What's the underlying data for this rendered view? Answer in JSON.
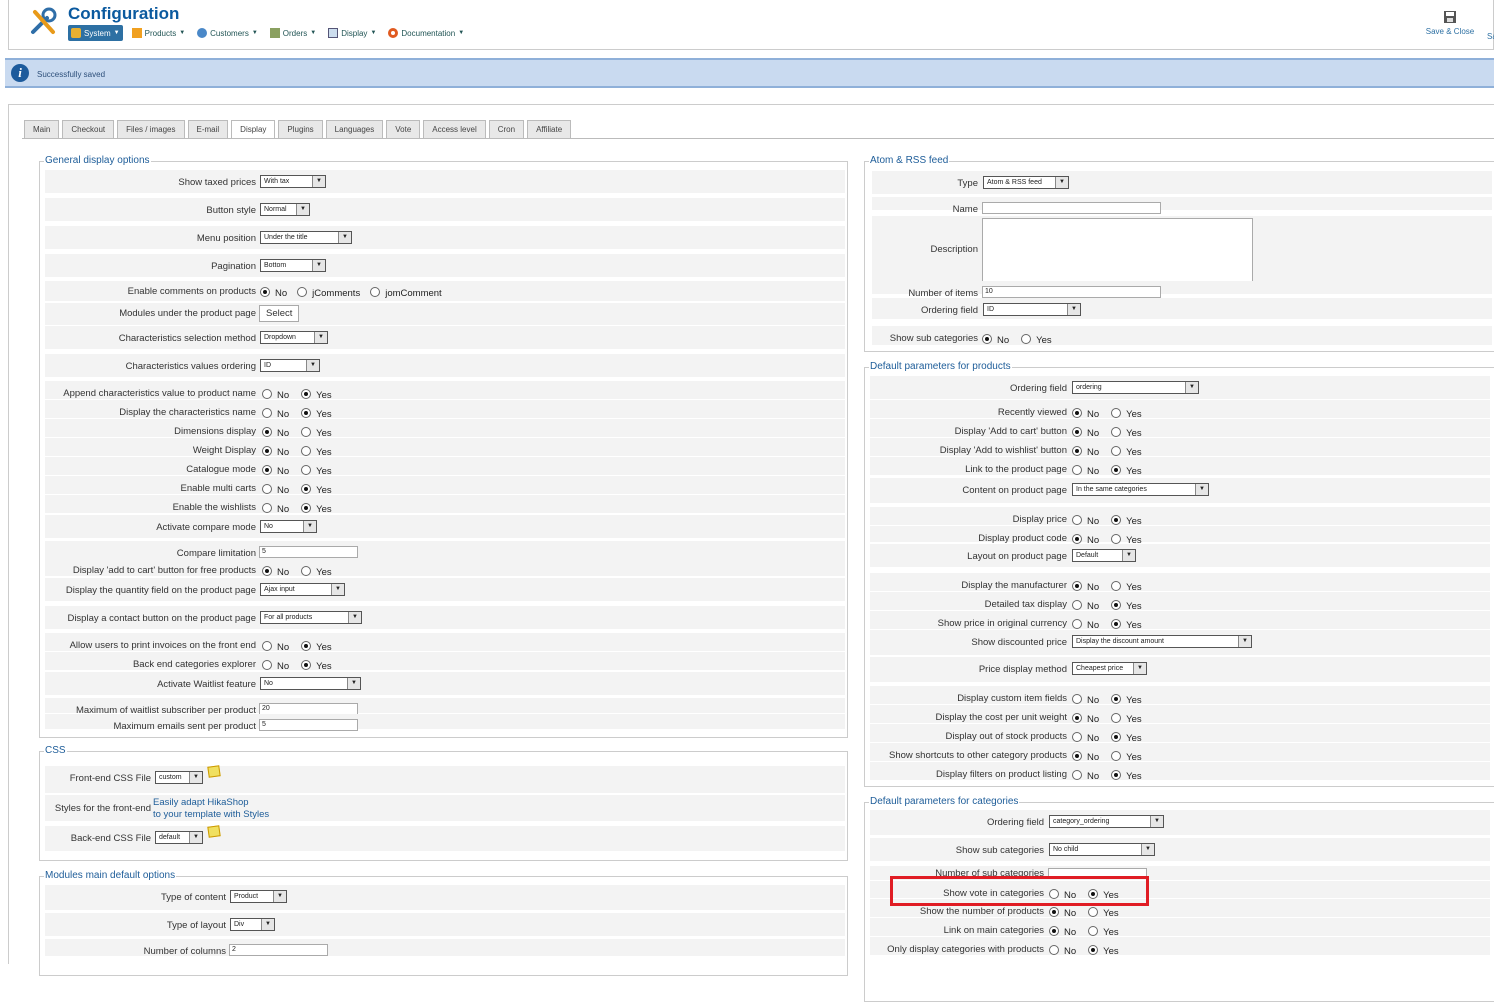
{
  "header": {
    "title": "Configuration",
    "menu": [
      {
        "label": "System",
        "icon": "wrench-icon",
        "active": true
      },
      {
        "label": "Products",
        "icon": "box-icon"
      },
      {
        "label": "Customers",
        "icon": "users-icon"
      },
      {
        "label": "Orders",
        "icon": "cart-icon"
      },
      {
        "label": "Display",
        "icon": "monitor-icon"
      },
      {
        "label": "Documentation",
        "icon": "lifebuoy-icon"
      }
    ],
    "save_close": "Save & Close",
    "save_more": "Sa"
  },
  "message": {
    "text": "Successfully saved",
    "icon": "info-icon"
  },
  "tabs": [
    "Main",
    "Checkout",
    "Files / images",
    "E-mail",
    "Display",
    "Plugins",
    "Languages",
    "Vote",
    "Access level",
    "Cron",
    "Affiliate"
  ],
  "active_tab": "Display",
  "general": {
    "legend": "General display options",
    "show_taxed_prices": {
      "label": "Show taxed prices",
      "value": "With tax"
    },
    "button_style": {
      "label": "Button style",
      "value": "Normal"
    },
    "menu_position": {
      "label": "Menu position",
      "value": "Under the title"
    },
    "pagination": {
      "label": "Pagination",
      "value": "Bottom"
    },
    "enable_comments": {
      "label": "Enable comments on products",
      "opt1": "No",
      "opt2": "jComments",
      "opt3": "jomComment"
    },
    "modules_under": {
      "label": "Modules under the product page",
      "button": "Select"
    },
    "char_selection": {
      "label": "Characteristics selection method",
      "value": "Dropdown"
    },
    "char_ordering": {
      "label": "Characteristics values ordering",
      "value": "ID"
    },
    "append_char": {
      "label": "Append characteristics value to product name"
    },
    "display_char_name": {
      "label": "Display the characteristics name"
    },
    "dimensions": {
      "label": "Dimensions display"
    },
    "weight": {
      "label": "Weight Display"
    },
    "catalogue": {
      "label": "Catalogue mode"
    },
    "multi_carts": {
      "label": "Enable multi carts"
    },
    "wishlists": {
      "label": "Enable the wishlists"
    },
    "compare_mode": {
      "label": "Activate compare mode",
      "value": "No"
    },
    "compare_limit": {
      "label": "Compare limitation",
      "value": "5"
    },
    "add_cart_free": {
      "label": "Display 'add to cart' button for free products"
    },
    "quantity_field": {
      "label": "Display the quantity field on the product page",
      "value": "Ajax input"
    },
    "contact_button": {
      "label": "Display a contact button on the product page",
      "value": "For all products"
    },
    "print_invoices": {
      "label": "Allow users to print invoices on the front end"
    },
    "backend_explorer": {
      "label": "Back end categories explorer"
    },
    "waitlist": {
      "label": "Activate Waitlist feature",
      "value": "No"
    },
    "max_waitlist": {
      "label": "Maximum of waitlist subscriber per product",
      "value": "20"
    },
    "max_emails": {
      "label": "Maximum emails sent per product",
      "value": "5"
    },
    "no": "No",
    "yes": "Yes"
  },
  "css": {
    "legend": "CSS",
    "frontend_file": {
      "label": "Front-end CSS File",
      "value": "custom"
    },
    "styles_frontend": {
      "label": "Styles for the front-end",
      "link1": "Easily adapt HikaShop",
      "link2": "to your template with Styles"
    },
    "backend_file": {
      "label": "Back-end CSS File",
      "value": "default"
    }
  },
  "modules": {
    "legend": "Modules main default options",
    "type_content": {
      "label": "Type of content",
      "value": "Product"
    },
    "type_layout": {
      "label": "Type of layout",
      "value": "Div"
    },
    "num_columns": {
      "label": "Number of columns",
      "value": "2"
    }
  },
  "rss": {
    "legend": "Atom & RSS feed",
    "type": {
      "label": "Type",
      "value": "Atom & RSS feed"
    },
    "name": {
      "label": "Name",
      "value": ""
    },
    "description": {
      "label": "Description"
    },
    "num_items": {
      "label": "Number of items",
      "value": "10"
    },
    "ordering": {
      "label": "Ordering field",
      "value": "ID"
    },
    "sub_categories": {
      "label": "Show sub categories"
    }
  },
  "products": {
    "legend": "Default parameters for products",
    "ordering": {
      "label": "Ordering field",
      "value": "ordering"
    },
    "recently_viewed": {
      "label": "Recently viewed"
    },
    "add_cart": {
      "label": "Display 'Add to cart' button"
    },
    "add_wishlist": {
      "label": "Display 'Add to wishlist' button"
    },
    "link_product": {
      "label": "Link to the product page"
    },
    "content_product": {
      "label": "Content on product page",
      "value": "In the same categories"
    },
    "display_price": {
      "label": "Display price"
    },
    "product_code": {
      "label": "Display product code"
    },
    "layout_product": {
      "label": "Layout on product page",
      "value": "Default"
    },
    "manufacturer": {
      "label": "Display the manufacturer"
    },
    "tax_display": {
      "label": "Detailed tax display"
    },
    "orig_currency": {
      "label": "Show price in original currency"
    },
    "discounted": {
      "label": "Show discounted price",
      "value": "Display the discount amount"
    },
    "price_method": {
      "label": "Price display method",
      "value": "Cheapest price"
    },
    "custom_fields": {
      "label": "Display custom item fields"
    },
    "cost_unit": {
      "label": "Display the cost per unit weight"
    },
    "out_of_stock": {
      "label": "Display out of stock products"
    },
    "shortcuts": {
      "label": "Show shortcuts to other category products"
    },
    "filters": {
      "label": "Display filters on product listing"
    }
  },
  "categories": {
    "legend": "Default parameters for categories",
    "ordering": {
      "label": "Ordering field",
      "value": "category_ordering"
    },
    "sub_categories": {
      "label": "Show sub categories",
      "value": "No child"
    },
    "num_sub": {
      "label": "Number of sub categories"
    },
    "vote": {
      "label": "Show vote in categories"
    },
    "num_products": {
      "label": "Show the number of products"
    },
    "link_main": {
      "label": "Link on main categories"
    },
    "only_with_products": {
      "label": "Only display categories with products"
    }
  },
  "colors": {
    "accent": "#1e5d99",
    "highlight": "#e01c24",
    "message_bg": "#c9daf0"
  }
}
